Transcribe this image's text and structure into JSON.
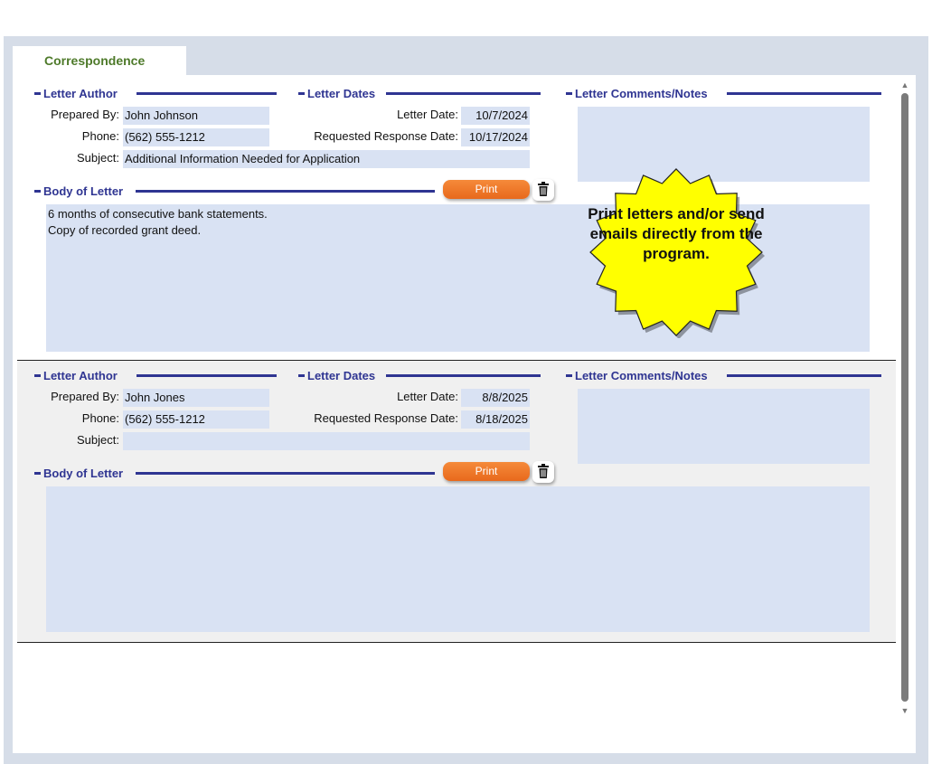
{
  "tab": {
    "label": "Correspondence"
  },
  "sections": {
    "author": "Letter Author",
    "dates": "Letter Dates",
    "comments": "Letter Comments/Notes",
    "body": "Body of Letter"
  },
  "labels": {
    "prepared_by": "Prepared By:",
    "phone": "Phone:",
    "subject": "Subject:",
    "letter_date": "Letter Date:",
    "requested_response_date": "Requested Response Date:"
  },
  "buttons": {
    "print": "Print"
  },
  "records": [
    {
      "prepared_by": "John Johnson",
      "phone": "(562) 555-1212",
      "subject": "Additional Information Needed for Application",
      "letter_date": "10/7/2024",
      "requested_response_date": "10/17/2024",
      "comments": "",
      "body": "6 months of consecutive bank statements.\nCopy of recorded grant deed."
    },
    {
      "prepared_by": "John Jones",
      "phone": "(562) 555-1212",
      "subject": "",
      "letter_date": "8/8/2025",
      "requested_response_date": "8/18/2025",
      "comments": "",
      "body": ""
    }
  ],
  "callout": {
    "text": "Print letters and/or send emails directly from the program."
  },
  "colors": {
    "section_blue": "#2f3592",
    "field_blue": "#d9e2f3",
    "print_orange": "#f07b2a",
    "callout_yellow": "#ffff00",
    "tab_green": "#4e7a2a"
  },
  "icons": {
    "delete": "trash-icon",
    "scroll_up": "up-arrow-icon",
    "scroll_down": "down-arrow-icon"
  }
}
